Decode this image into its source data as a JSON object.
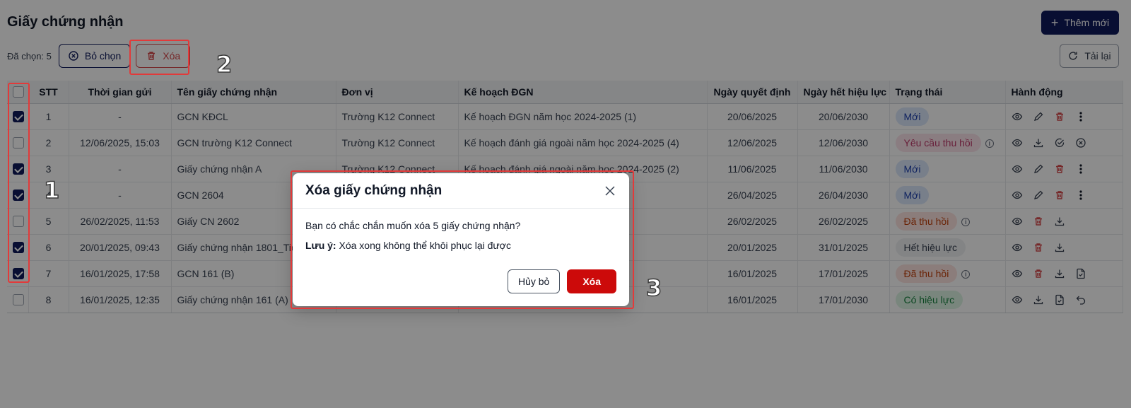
{
  "page": {
    "title": "Giấy chứng nhận",
    "add_button": "Thêm mới",
    "reload_button": "Tải lại"
  },
  "selection": {
    "count_label": "Đã chọn: 5",
    "clear_button": "Bỏ chọn",
    "delete_button": "Xóa"
  },
  "table": {
    "headers": [
      "",
      "STT",
      "Thời gian gửi",
      "Tên giấy chứng nhận",
      "Đơn vị",
      "Kế hoạch ĐGN",
      "Ngày quyết định",
      "Ngày hết hiệu lực",
      "Trạng thái",
      "Hành động"
    ],
    "rows": [
      {
        "checked": true,
        "stt": "1",
        "sent": "-",
        "name": "GCN KĐCL",
        "unit": "Trường K12 Connect",
        "plan": "Kế hoạch ĐGN năm học 2024-2025 (1)",
        "decided": "20/06/2025",
        "expires": "20/06/2030",
        "status": "Mới",
        "status_type": "moi",
        "status_info": false,
        "actions": [
          "eye-icon",
          "pencil-icon",
          "trash-icon",
          "more-vertical-icon"
        ]
      },
      {
        "checked": false,
        "stt": "2",
        "sent": "12/06/2025, 15:03",
        "name": "GCN trường K12 Connect",
        "unit": "Trường K12 Connect",
        "plan": "Kế hoạch đánh giá ngoài năm học 2024-2025 (4)",
        "decided": "12/06/2025",
        "expires": "12/06/2030",
        "status": "Yêu cầu thu hồi",
        "status_type": "req",
        "status_info": true,
        "actions": [
          "eye-icon",
          "download-icon",
          "check-circle-icon",
          "x-circle-icon"
        ]
      },
      {
        "checked": true,
        "stt": "3",
        "sent": "-",
        "name": "Giấy chứng nhận A",
        "unit": "Trường K12 Connect",
        "plan": "Kế hoạch đánh giá ngoài năm học 2024-2025 (2)",
        "decided": "11/06/2025",
        "expires": "11/06/2030",
        "status": "Mới",
        "status_type": "moi",
        "status_info": false,
        "actions": [
          "eye-icon",
          "pencil-icon",
          "trash-icon",
          "more-vertical-icon"
        ]
      },
      {
        "checked": true,
        "stt": "4",
        "sent": "-",
        "name": "GCN 2604",
        "unit": "",
        "plan": "",
        "decided": "26/04/2025",
        "expires": "26/04/2030",
        "status": "Mới",
        "status_type": "moi",
        "status_info": false,
        "actions": [
          "eye-icon",
          "pencil-icon",
          "trash-icon",
          "more-vertical-icon"
        ]
      },
      {
        "checked": false,
        "stt": "5",
        "sent": "26/02/2025, 11:53",
        "name": "Giấy CN 2602",
        "unit": "",
        "plan": "",
        "decided": "26/02/2025",
        "expires": "26/02/2025",
        "status": "Đã thu hồi",
        "status_type": "thu",
        "status_info": true,
        "actions": [
          "eye-icon",
          "trash-icon",
          "download-icon"
        ]
      },
      {
        "checked": true,
        "stt": "6",
        "sent": "20/01/2025, 09:43",
        "name": "Giấy chứng nhận 1801_Tiế",
        "unit": "",
        "plan": "",
        "decided": "20/01/2025",
        "expires": "31/01/2025",
        "status": "Hết hiệu lực",
        "status_type": "het",
        "status_info": false,
        "actions": [
          "eye-icon",
          "trash-icon",
          "download-icon"
        ]
      },
      {
        "checked": true,
        "stt": "7",
        "sent": "16/01/2025, 17:58",
        "name": "GCN 161 (B)",
        "unit": "",
        "plan": "",
        "decided": "16/01/2025",
        "expires": "17/01/2025",
        "status": "Đã thu hồi",
        "status_type": "thu",
        "status_info": true,
        "actions": [
          "eye-icon",
          "trash-icon",
          "download-icon",
          "file-check-icon"
        ]
      },
      {
        "checked": false,
        "stt": "8",
        "sent": "16/01/2025, 12:35",
        "name": "Giấy chứng nhận 161 (A)",
        "unit": "",
        "plan": "",
        "decided": "16/01/2025",
        "expires": "17/01/2030",
        "status": "Có hiệu lực",
        "status_type": "co",
        "status_info": false,
        "actions": [
          "eye-icon",
          "download-icon",
          "file-check-icon",
          "undo-icon"
        ]
      }
    ]
  },
  "dialog": {
    "title": "Xóa giấy chứng nhận",
    "question": "Bạn có chắc chắn muốn xóa 5 giấy chứng nhận?",
    "note_label": "Lưu ý:",
    "note_text": "Xóa xong không thể khôi phục lại được",
    "cancel": "Hủy bỏ",
    "confirm": "Xóa"
  },
  "annotations": {
    "marker_1": "1",
    "marker_2": "2",
    "marker_3": "3"
  },
  "colors": {
    "primary": "#0f1b5c",
    "danger": "#cc0a0a",
    "highlight": "#e23a3a"
  }
}
